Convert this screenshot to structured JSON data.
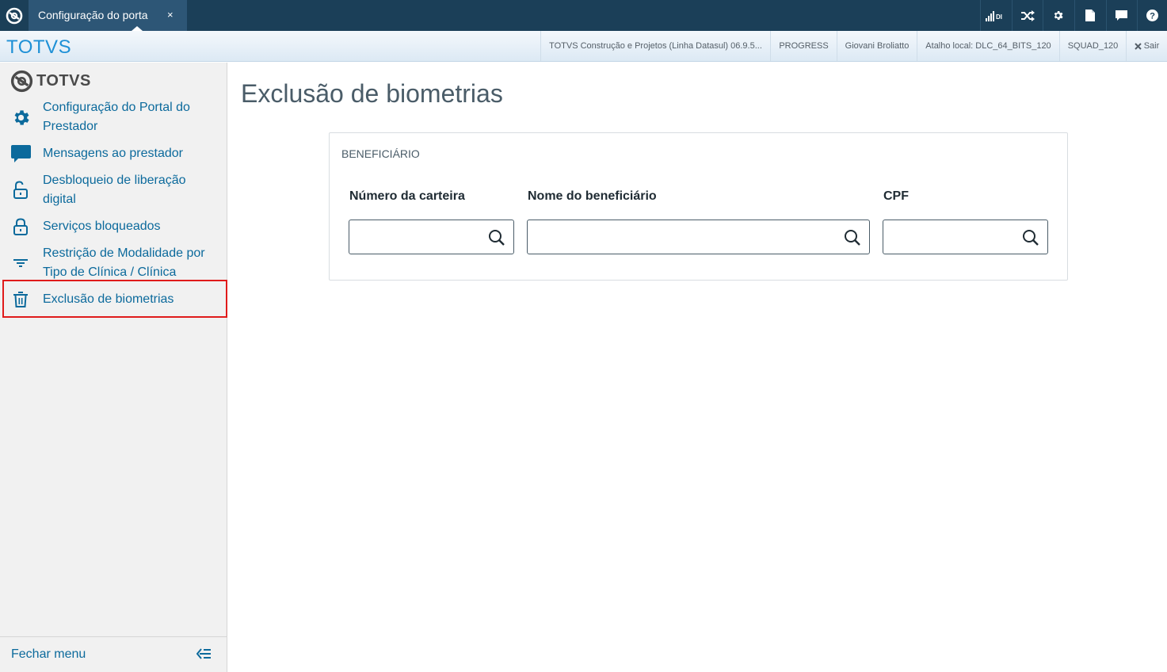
{
  "topbar": {
    "tab_label": "Configuração do porta",
    "tab_close": "×",
    "tools": [
      {
        "icon": "signal-bars-icon",
        "text": "DI"
      },
      {
        "icon": "shuffle-icon"
      },
      {
        "icon": "gear-icon"
      },
      {
        "icon": "document-icon"
      },
      {
        "icon": "chat-icon"
      },
      {
        "icon": "help-icon"
      }
    ]
  },
  "infobar": {
    "brand": "TOTVS",
    "items": [
      "TOTVS Construção e Projetos (Linha Datasul) 06.9.5...",
      "PROGRESS",
      "Giovani Broliatto",
      "Atalho local: DLC_64_BITS_120",
      "SQUAD_120"
    ],
    "logout": "Sair"
  },
  "sidebar": {
    "logo_text": "TOTVS",
    "items": [
      {
        "label": "Configuração do Portal do Prestador",
        "icon": "gear-icon"
      },
      {
        "label": "Mensagens ao prestador",
        "icon": "chat-icon"
      },
      {
        "label": "Desbloqueio de liberação digital",
        "icon": "unlock-icon"
      },
      {
        "label": "Serviços bloqueados",
        "icon": "lock-icon"
      },
      {
        "label": "Restrição de Modalidade por Tipo de Clínica / Clínica",
        "icon": "filter-icon"
      },
      {
        "label": "Exclusão de biometrias",
        "icon": "trash-icon",
        "active": true
      }
    ],
    "footer_label": "Fechar menu"
  },
  "main": {
    "title": "Exclusão de biometrias",
    "card_title": "BENEFICIÁRIO",
    "fields": [
      {
        "label": "Número da carteira",
        "value": ""
      },
      {
        "label": "Nome do beneficiário",
        "value": ""
      },
      {
        "label": "CPF",
        "value": ""
      }
    ]
  },
  "colors": {
    "topbar": "#1b3f58",
    "tab": "#2d5676",
    "brand": "#1e90d6",
    "link": "#0c6a9c",
    "highlight": "#e01b1b"
  }
}
